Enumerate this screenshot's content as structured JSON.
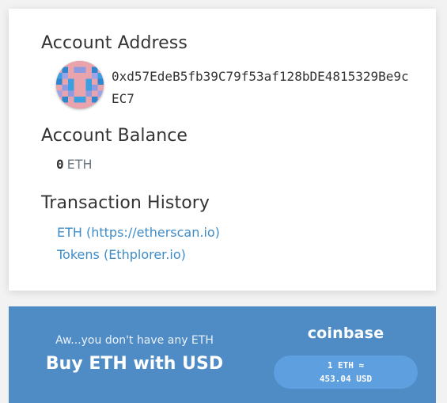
{
  "account": {
    "address_title": "Account Address",
    "address": "0xd57EdeB5fb39C79f53af128bDE4815329Be9cEC7",
    "avatar_icon": "identicon-avatar",
    "balance_title": "Account Balance",
    "balance_value": "0",
    "balance_unit": "ETH",
    "history_title": "Transaction History",
    "history_links": [
      {
        "label": "ETH (https://etherscan.io)"
      },
      {
        "label": "Tokens (Ethplorer.io)"
      }
    ]
  },
  "buy": {
    "subtitle": "Aw...you don't have any ETH",
    "title": "Buy ETH with USD",
    "provider": "coinbase",
    "rate_line1": "1 ETH ≈",
    "rate_line2": "453.04 USD"
  },
  "colors": {
    "link": "#3e8cc8",
    "panel": "#4f8cc5",
    "pill": "#5e9fe0"
  }
}
